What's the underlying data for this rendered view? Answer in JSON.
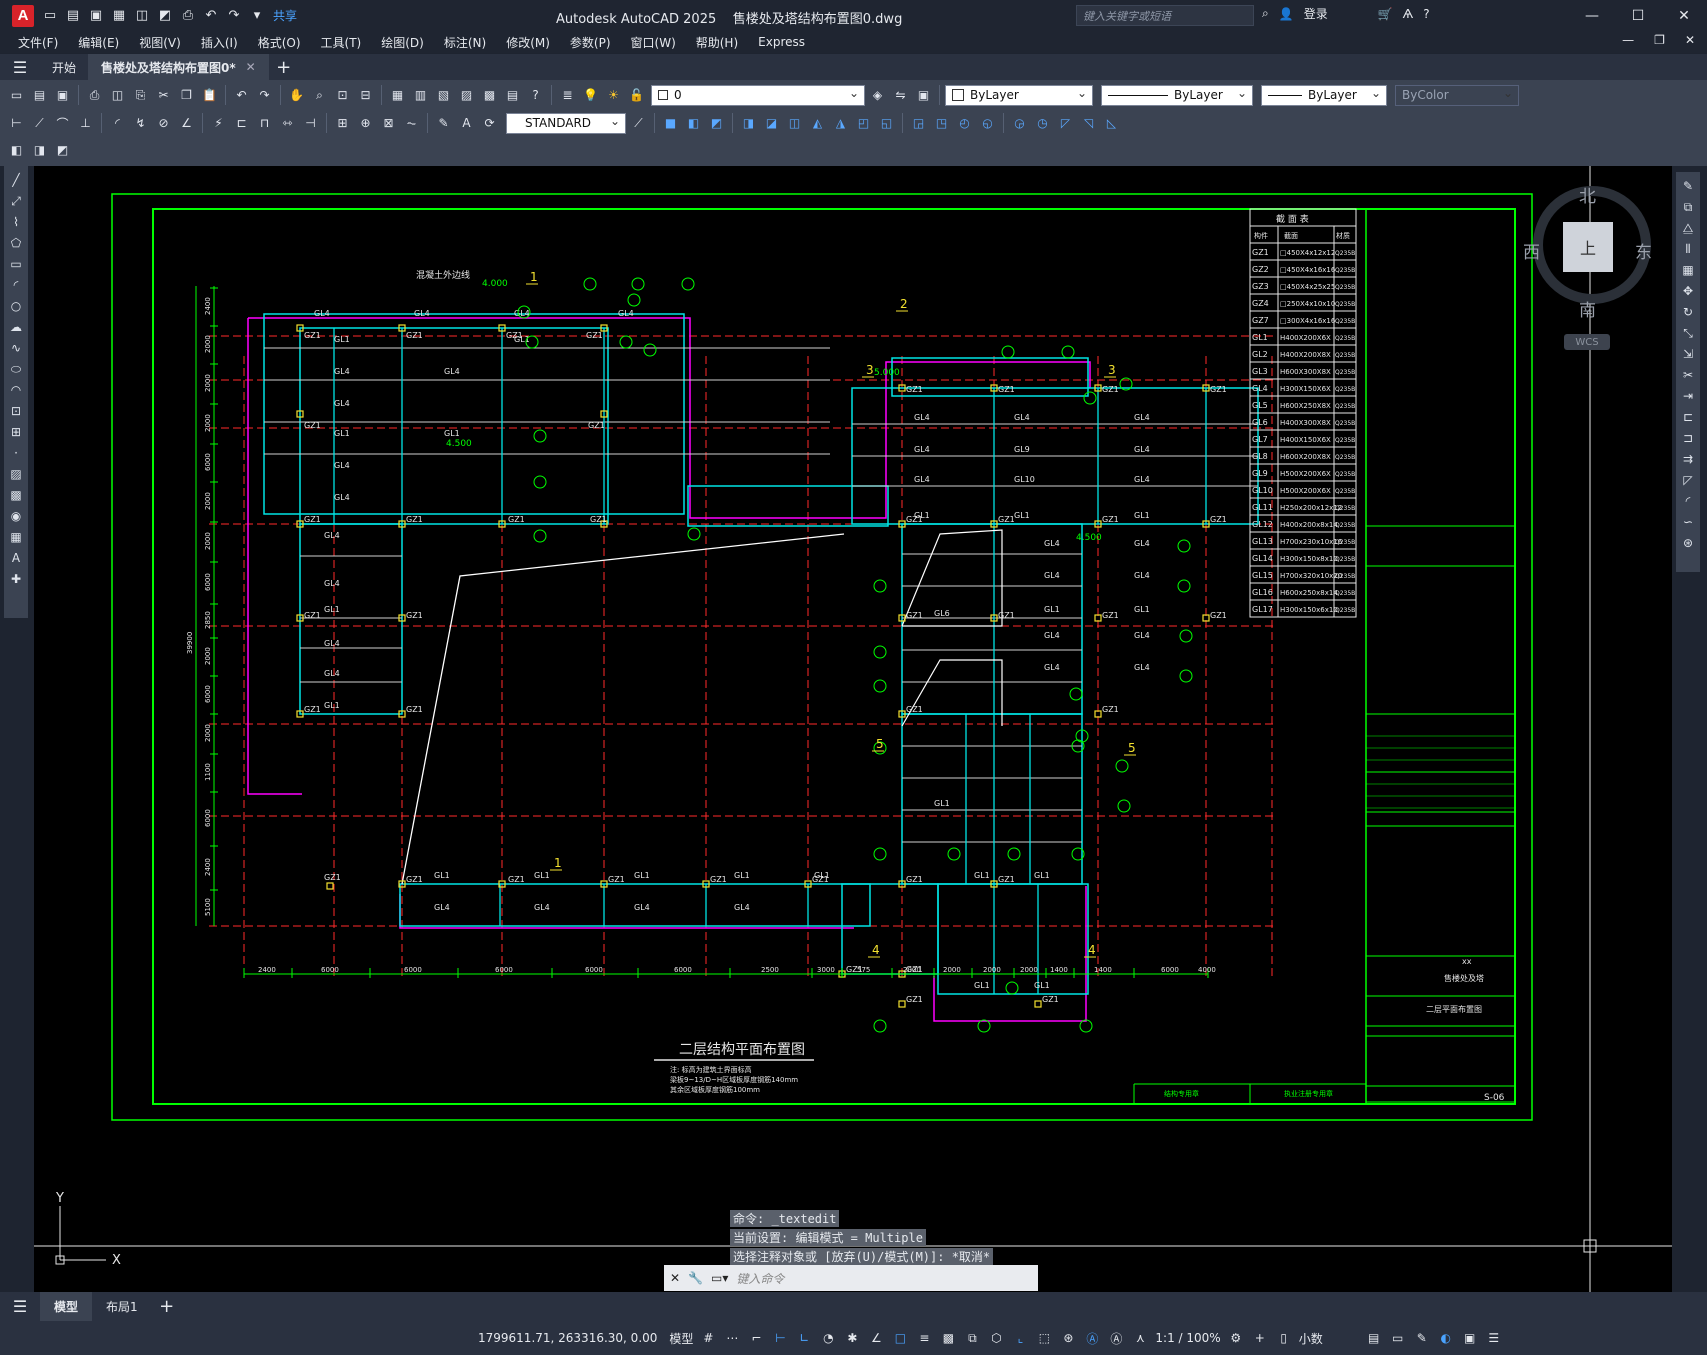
{
  "app": {
    "title": "Autodesk AutoCAD 2025",
    "file": "售楼处及塔结构布置图0.dwg",
    "share": "共享",
    "search_placeholder": "键入关键字或短语",
    "login": "登录"
  },
  "menu": [
    "文件(F)",
    "编辑(E)",
    "视图(V)",
    "插入(I)",
    "格式(O)",
    "工具(T)",
    "绘图(D)",
    "标注(N)",
    "修改(M)",
    "参数(P)",
    "窗口(W)",
    "帮助(H)",
    "Express"
  ],
  "tabs": {
    "start": "开始",
    "doc": "售楼处及塔结构布置图0*"
  },
  "toolbar": {
    "layer": "0",
    "textstyle": "STANDARD",
    "color": "ByLayer",
    "linetype": "ByLayer",
    "lineweight": "ByLayer",
    "plotstyle": "ByColor"
  },
  "viewcube": {
    "north": "北",
    "south": "南",
    "east": "东",
    "west": "西",
    "top": "上",
    "wcs": "WCS"
  },
  "drawing": {
    "title": "二层结构平面布置图",
    "notes": [
      "注: 标高为建筑土界面标高",
      "梁板9~13/D~H区域板厚度钢筋140mm",
      "其余区域板厚度钢筋100mm"
    ],
    "section_header": "截 面 表",
    "section_cols": [
      "构件",
      "截面",
      "材质"
    ],
    "sections": [
      [
        "GZ1",
        "□450X4x12x12",
        "Q235B"
      ],
      [
        "GZ2",
        "□450X4x16x16",
        "Q235B"
      ],
      [
        "GZ3",
        "□450X4x25x25",
        "Q235B"
      ],
      [
        "GZ4",
        "□250X4x10x10",
        "Q235B"
      ],
      [
        "GZ7",
        "□300X4x16x16",
        "Q235B"
      ],
      [
        "GL1",
        "H400X200X6X",
        "Q235B"
      ],
      [
        "GL2",
        "H400X200X8X",
        "Q235B"
      ],
      [
        "GL3",
        "H600X300X8X",
        "Q235B"
      ],
      [
        "GL4",
        "H300X150X6X",
        "Q235B"
      ],
      [
        "GL5",
        "H600X250X8X",
        "Q235B"
      ],
      [
        "GL6",
        "H400X300X8X",
        "Q235B"
      ],
      [
        "GL7",
        "H400X150X6X",
        "Q235B"
      ],
      [
        "GL8",
        "H600X200X8X",
        "Q235B"
      ],
      [
        "GL9",
        "H500X200X6X",
        "Q235B"
      ],
      [
        "GL10",
        "H500X200X6X",
        "Q235B"
      ],
      [
        "GL11",
        "H250x200x12x12",
        "Q235B"
      ],
      [
        "GL12",
        "H400x200x8x14",
        "Q235B"
      ],
      [
        "GL13",
        "H700x230x10x16",
        "Q235B"
      ],
      [
        "GL14",
        "H300x150x8x10",
        "Q235B"
      ],
      [
        "GL15",
        "H700x320x10x20",
        "Q235B"
      ],
      [
        "GL16",
        "H600x250x8x14",
        "Q235B"
      ],
      [
        "GL17",
        "H300x150x6x10",
        "Q235B"
      ]
    ],
    "dims_bottom": [
      "2400",
      "6000",
      "6000",
      "6000",
      "6000",
      "6000",
      "2500",
      "3000",
      "575",
      "2000",
      "2000",
      "2000",
      "2000",
      "1400",
      "1400",
      "6000",
      "4000"
    ],
    "dims_left": [
      "2400",
      "2000",
      "2000",
      "2000",
      "6000",
      "2000",
      "2000",
      "6000",
      "2850",
      "2000",
      "6000",
      "2000",
      "1100",
      "6000",
      "2400",
      "5100"
    ],
    "dim_total": "39900",
    "annot": {
      "a": "混凝土外边线",
      "lv1": "4.000",
      "lv2": "4.500",
      "lv3": "5.000",
      "lv4": "4.500"
    },
    "stamp": {
      "client": "xx",
      "project": "售楼处及塔",
      "drawing": "二层平面布置图",
      "no": "S-06",
      "a": "结构专用章",
      "b": "执业注册专用章"
    },
    "beam": "GL4",
    "col": "GZ1"
  },
  "command": {
    "line1": "命令: _textedit",
    "line2": "当前设置: 编辑模式 = Multiple",
    "line3": "选择注释对象或 [放弃(U)/模式(M)]: *取消*",
    "placeholder": "键入命令"
  },
  "layout_tabs": [
    "模型",
    "布局1"
  ],
  "status": {
    "coords": "1799611.71, 263316.30, 0.00",
    "model": "模型",
    "scale": "1:1 / 100%",
    "units": "小数"
  },
  "colors": {
    "frame": "#00ff00",
    "beam": "#00e5e5",
    "grid": "#ff2a2a",
    "outline": "#ff00ff"
  }
}
